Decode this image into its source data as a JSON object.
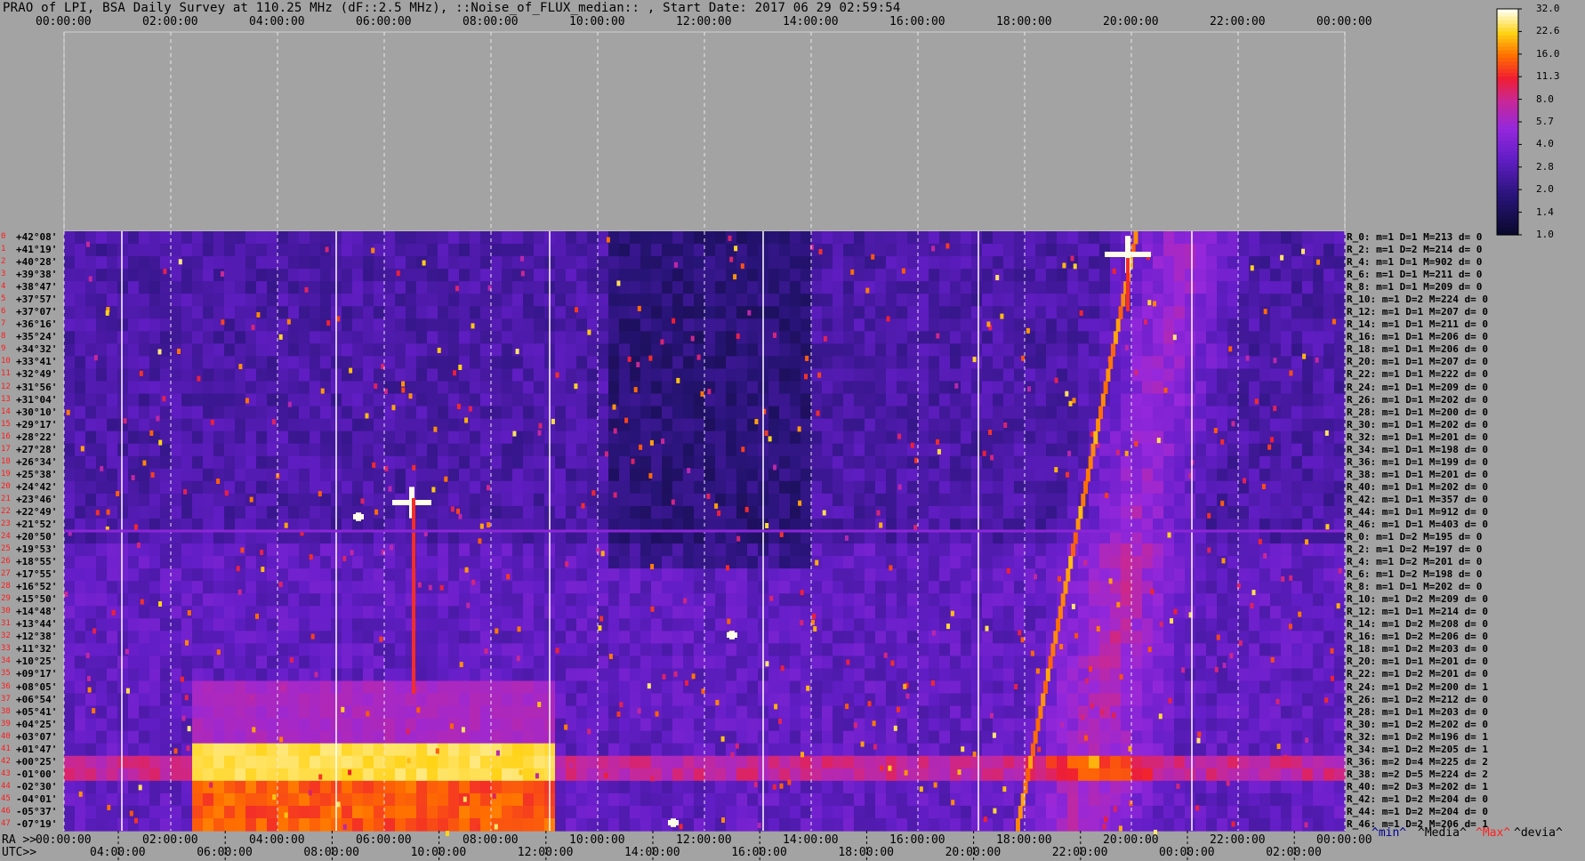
{
  "title": "PRAO of LPI, BSA Daily Survey at 110.25 MHz (dF::2.5 MHz), ::Noise_of_FLUX_median:: , Start Date: 2017 06 29 02:59:54",
  "chart_data": {
    "type": "heatmap",
    "top_time_ticks": [
      "00:00:00",
      "02:00:00",
      "04:00:00",
      "06:00:00",
      "08:00:00",
      "10:00:00",
      "12:00:00",
      "14:00:00",
      "16:00:00",
      "18:00:00",
      "20:00:00",
      "22:00:00",
      "00:00:00"
    ],
    "ra_row_label": "RA >>",
    "ra_ticks": [
      "00:00:00",
      "02:00:00",
      "04:00:00",
      "06:00:00",
      "08:00:00",
      "10:00:00",
      "12:00:00",
      "14:00:00",
      "16:00:00",
      "18:00:00",
      "20:00:00",
      "22:00:00",
      "00:00:00"
    ],
    "utc_row_label": "UTC>>",
    "utc_ticks": [
      "04:00:00",
      "06:00:00",
      "08:00:00",
      "10:00:00",
      "12:00:00",
      "14:00:00",
      "16:00:00",
      "18:00:00",
      "20:00:00",
      "22:00:00",
      "00:00:00",
      "02:00:00"
    ],
    "colorbar_ticks": [
      "32.0",
      "22.6",
      "16.0",
      "11.3",
      "8.0",
      "5.7",
      "4.0",
      "2.8",
      "2.0",
      "1.4",
      "1.0"
    ],
    "declinations": [
      "+42°08'",
      "+41°19'",
      "+40°28'",
      "+39°38'",
      "+38°47'",
      "+37°57'",
      "+37°07'",
      "+36°16'",
      "+35°24'",
      "+34°32'",
      "+33°41'",
      "+32°49'",
      "+31°56'",
      "+31°04'",
      "+30°10'",
      "+29°17'",
      "+28°22'",
      "+27°28'",
      "+26°34'",
      "+25°38'",
      "+24°42'",
      "+23°46'",
      "+22°49'",
      "+21°52'",
      "+20°50'",
      "+19°53'",
      "+18°55'",
      "+17°55'",
      "+16°52'",
      "+15°50'",
      "+14°48'",
      "+13°44'",
      "+12°38'",
      "+11°32'",
      "+10°25'",
      "+09°17'",
      "+08°05'",
      "+06°54'",
      "+05°41'",
      "+04°25'",
      "+03°07'",
      "+01°47'",
      "+00°25'",
      "-01°00'",
      "-02°30'",
      "-04°01'",
      "-05°37'",
      "-07°19'"
    ],
    "receivers": [
      "R_0: m=1 D=1 M=213 d= 0",
      "R_2: m=1 D=2 M=214 d= 0",
      "R_4: m=1 D=1 M=902 d= 0",
      "R_6: m=1 D=1 M=211 d= 0",
      "R_8: m=1 D=1 M=209 d= 0",
      "R_10: m=1 D=2 M=224 d= 0",
      "R_12: m=1 D=1 M=207 d= 0",
      "R_14: m=1 D=1 M=211 d= 0",
      "R_16: m=1 D=1 M=206 d= 0",
      "R_18: m=1 D=1 M=206 d= 0",
      "R_20: m=1 D=1 M=207 d= 0",
      "R_22: m=1 D=1 M=222 d= 0",
      "R_24: m=1 D=1 M=209 d= 0",
      "R_26: m=1 D=1 M=202 d= 0",
      "R_28: m=1 D=1 M=200 d= 0",
      "R_30: m=1 D=1 M=202 d= 0",
      "R_32: m=1 D=1 M=201 d= 0",
      "R_34: m=1 D=1 M=198 d= 0",
      "R_36: m=1 D=1 M=199 d= 0",
      "R_38: m=1 D=1 M=201 d= 0",
      "R_40: m=1 D=1 M=202 d= 0",
      "R_42: m=1 D=1 M=357 d= 0",
      "R_44: m=1 D=1 M=912 d= 0",
      "R_46: m=1 D=1 M=403 d= 0",
      "R_0: m=1 D=2 M=195 d= 0",
      "R_2: m=1 D=2 M=197 d= 0",
      "R_4: m=1 D=2 M=201 d= 0",
      "R_6: m=1 D=2 M=198 d= 0",
      "R_8: m=1 D=1 M=202 d= 0",
      "R_10: m=1 D=2 M=209 d= 0",
      "R_12: m=1 D=1 M=214 d= 0",
      "R_14: m=1 D=2 M=208 d= 0",
      "R_16: m=1 D=2 M=206 d= 0",
      "R_18: m=1 D=2 M=203 d= 0",
      "R_20: m=1 D=1 M=201 d= 0",
      "R_22: m=1 D=2 M=201 d= 0",
      "R_24: m=1 D=2 M=200 d= 1",
      "R_26: m=1 D=2 M=212 d= 0",
      "R_28: m=1 D=1 M=203 d= 0",
      "R_30: m=1 D=2 M=202 d= 0",
      "R_32: m=1 D=2 M=196 d= 1",
      "R_34: m=1 D=2 M=205 d= 1",
      "R_36: m=2 D=4 M=225 d= 2",
      "R_38: m=2 D=5 M=224 d= 2",
      "R_40: m=2 D=3 M=202 d= 1",
      "R_42: m=1 D=2 M=204 d= 0",
      "R_44: m=1 D=2 M=204 d= 0",
      "R_46: m=1 D=2 M=206 d= 1"
    ],
    "footer_legend": [
      "^min^",
      "^Media^",
      "^Max^",
      "^devia^"
    ]
  },
  "colors": {
    "background": "#a3a3a3",
    "label_red": "#ff1a1a",
    "label_dark": "#000000",
    "min_color": "#000090",
    "max_color": "#ff2020"
  }
}
